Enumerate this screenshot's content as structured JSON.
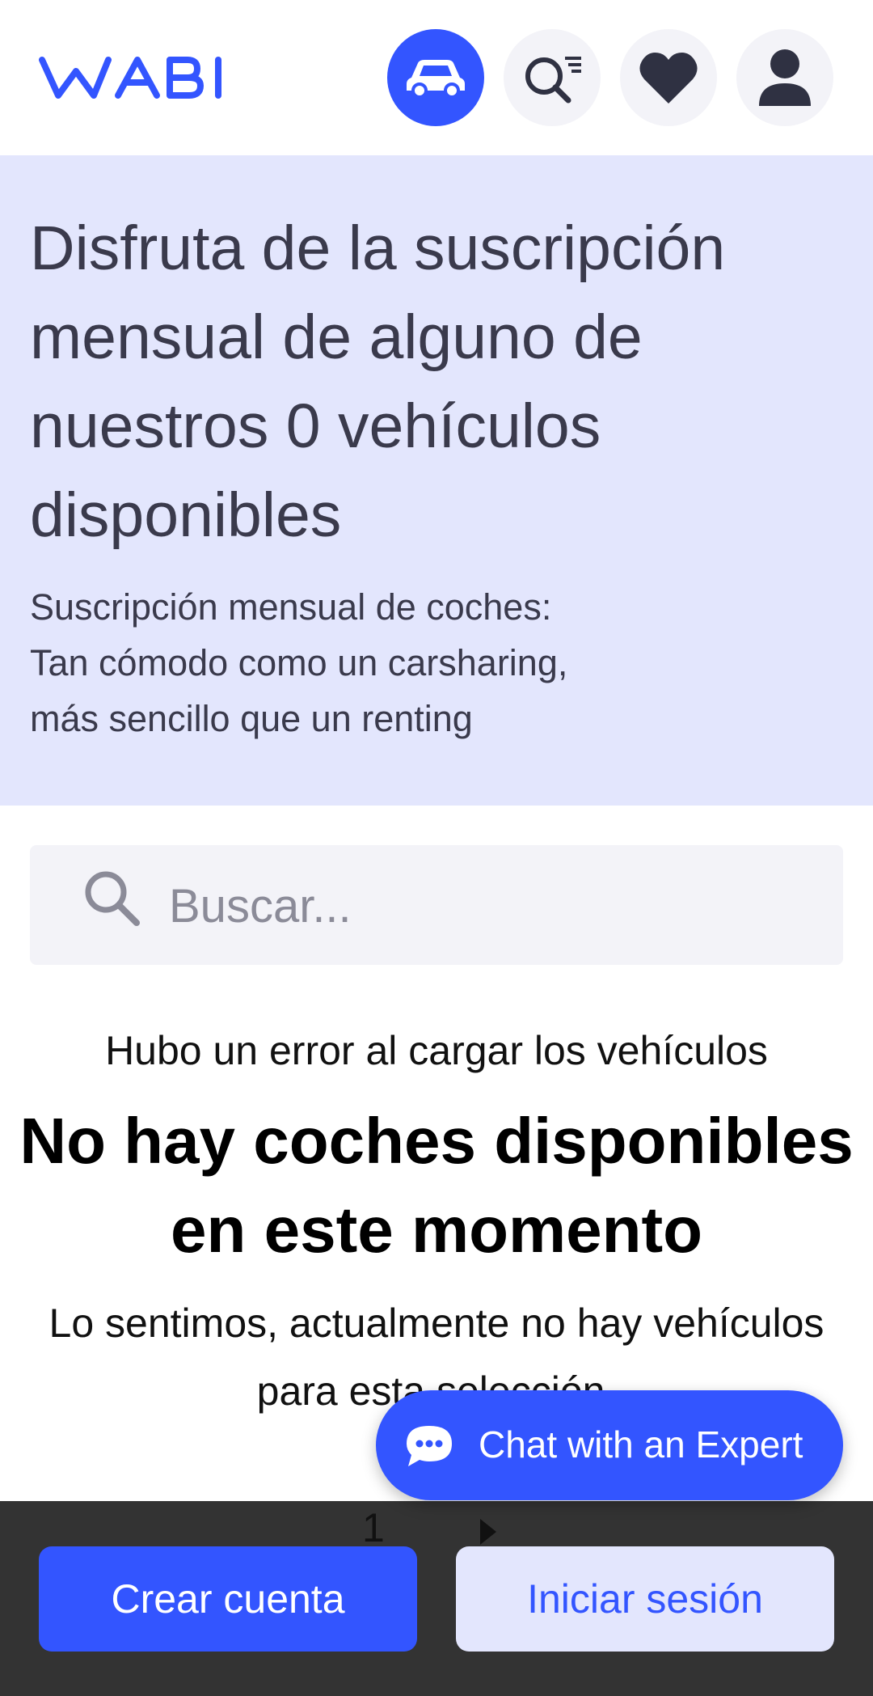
{
  "header": {
    "logo_text": "WABI",
    "nav": [
      {
        "icon": "car-icon",
        "active": true
      },
      {
        "icon": "search-filter-icon",
        "active": false
      },
      {
        "icon": "heart-icon",
        "active": false
      },
      {
        "icon": "user-icon",
        "active": false
      }
    ]
  },
  "hero": {
    "title": "Disfruta de la suscripción mensual de alguno de nuestros 0 vehículos disponibles",
    "subtitle_lines": [
      "Suscripción mensual de coches:",
      "Tan cómodo como un carsharing,",
      "más sencillo que un renting"
    ]
  },
  "search": {
    "placeholder": "Buscar...",
    "value": ""
  },
  "results": {
    "error_message": "Hubo un error al cargar los vehículos",
    "empty_title": "No hay coches disponibles en este momento",
    "empty_description": "Lo sentimos, actualmente no hay vehículos para esta selección."
  },
  "pagination": {
    "current_page": "1"
  },
  "chat": {
    "label": "Chat with an Expert"
  },
  "footer": {
    "create_account": "Crear cuenta",
    "login": "Iniciar sesión"
  },
  "colors": {
    "brand": "#3355ff",
    "hero_bg": "#e3e6fd",
    "bar_bg": "#333333"
  }
}
